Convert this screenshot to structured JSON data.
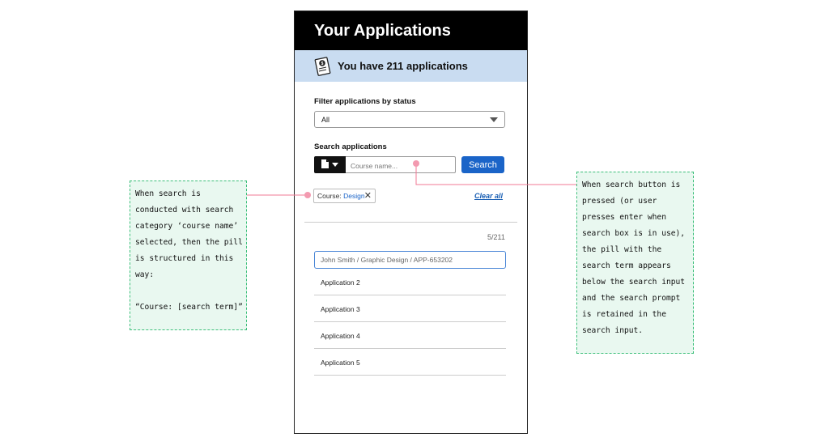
{
  "app": {
    "title": "Your Applications",
    "banner_text": "You have 211 applications",
    "filter": {
      "label": "Filter applications by status",
      "selected": "All"
    },
    "search": {
      "label": "Search applications",
      "category_icon": "document-icon",
      "placeholder": "Course name...",
      "button_label": "Search"
    },
    "pill": {
      "prefix": "Course: ",
      "term": "Design",
      "remove_icon": "close-icon"
    },
    "clear_all_label": "Clear all",
    "result_count": "5/211",
    "filter_placeholder": "John Smith / Graphic Design / APP-653202",
    "applications": [
      "Application 2",
      "Application 3",
      "Application 4",
      "Application 5"
    ]
  },
  "annotations": {
    "left": "When search is\nconducted with search\ncategory ‘course name’\nselected, then the pill\nis structured in this\nway:\n\n“Course: [search term]”",
    "right": "When search button is\npressed (or user\npresses enter when\nsearch box is in use),\nthe pill with the\nsearch term appears\nbelow the search input\nand the search prompt\nis retained in the\nsearch input."
  },
  "colors": {
    "accent": "#1a64c8",
    "banner": "#c9dcf1",
    "callout_border": "#3cbf7a",
    "callout_bg": "#e9f8f0",
    "connector": "#f07a95"
  }
}
